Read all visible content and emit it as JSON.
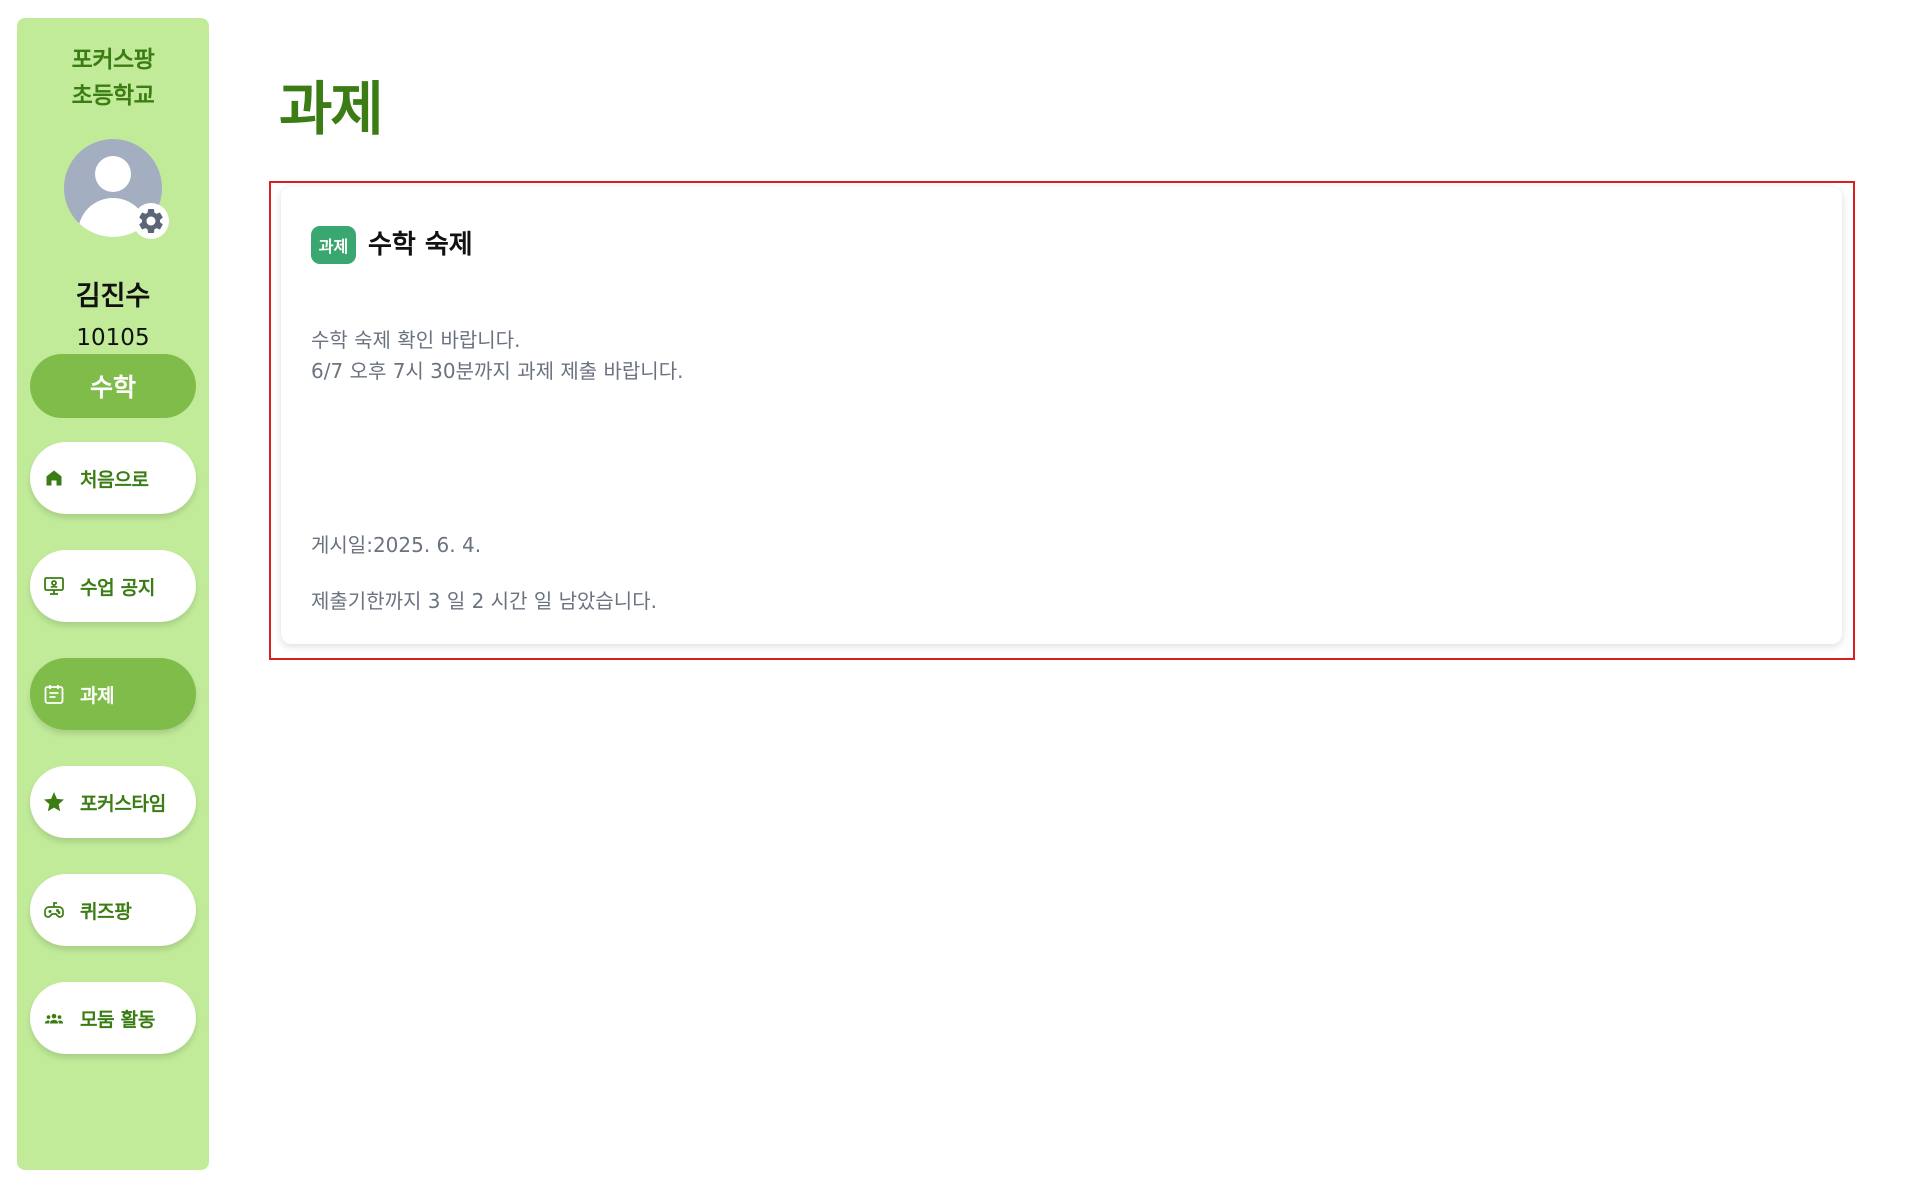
{
  "sidebar": {
    "school_line1": "포커스팡",
    "school_line2": "초등학교",
    "student_name": "김진수",
    "student_id": "10105",
    "subject": "수학",
    "nav_items": [
      {
        "label": "처음으로",
        "icon": "home-icon",
        "active": false
      },
      {
        "label": "수업 공지",
        "icon": "presentation-icon",
        "active": false
      },
      {
        "label": "과제",
        "icon": "assignment-icon",
        "active": true
      },
      {
        "label": "포커스타임",
        "icon": "star-icon",
        "active": false
      },
      {
        "label": "퀴즈팡",
        "icon": "gamepad-icon",
        "active": false
      },
      {
        "label": "모둠 활동",
        "icon": "group-icon",
        "active": false
      }
    ]
  },
  "main": {
    "page_title": "과제",
    "assignment": {
      "badge": "과제",
      "title": "수학 숙제",
      "body_line1": "수학 숙제 확인 바랍니다.",
      "body_line2": "6/7 오후 7시 30분까지 과제 제출 바랍니다.",
      "posted": "게시일:2025. 6. 4.",
      "deadline": "제출기한까지 3 일 2 시간 일 남았습니다."
    }
  },
  "colors": {
    "sidebar_bg": "#c1eb99",
    "accent_green": "#7fbc49",
    "dark_green": "#3b7d14",
    "badge_green": "#3aa670",
    "highlight_red": "#d92020"
  }
}
